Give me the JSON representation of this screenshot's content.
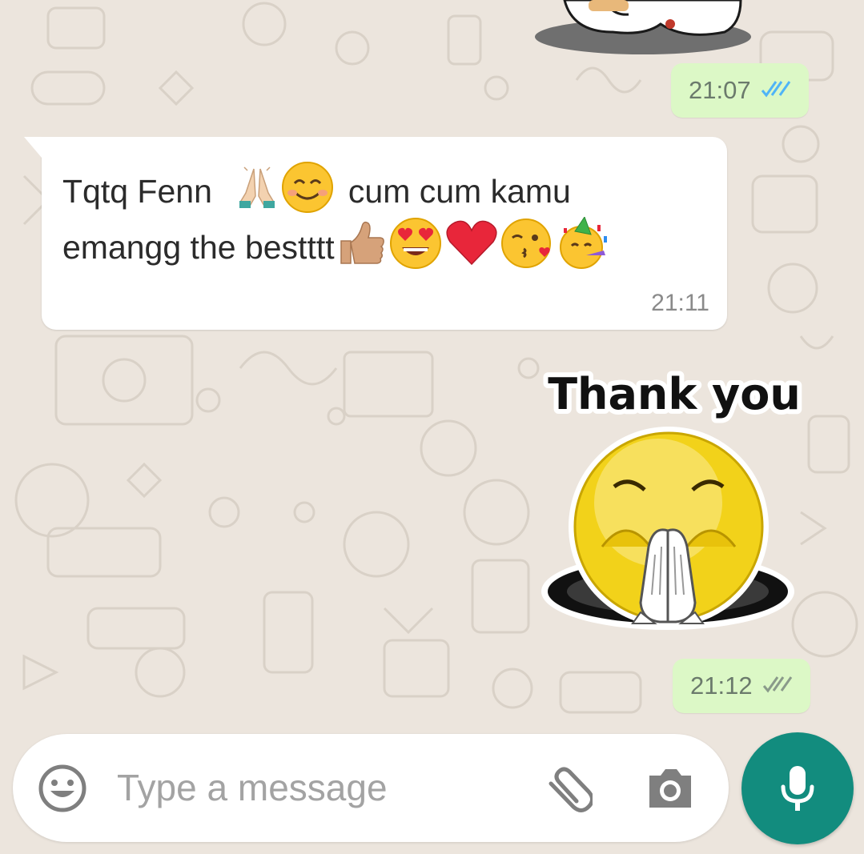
{
  "messages": [
    {
      "direction": "out",
      "type": "sticker",
      "time": "21:07",
      "status": "read"
    },
    {
      "direction": "in",
      "type": "text",
      "line1_text_a": "Tqtq Fenn",
      "line1_emojis": [
        "folded-hands-emoji",
        "smiling-face-emoji"
      ],
      "line1_text_b": "cum cum kamu",
      "line2_text": "emangg the bestttt",
      "line2_emojis": [
        "thumbs-up-emoji",
        "heart-eyes-emoji",
        "red-heart-emoji",
        "kissing-face-emoji",
        "partying-face-emoji"
      ],
      "time": "21:11"
    },
    {
      "direction": "out",
      "type": "sticker",
      "sticker_text": "Thank you",
      "time": "21:12",
      "status": "read"
    }
  ],
  "composer": {
    "placeholder": "Type a message",
    "icons": [
      "emoji-icon",
      "attachment-icon",
      "camera-icon",
      "microphone-icon"
    ]
  },
  "colors": {
    "wallpaper": "#ece5dd",
    "outgoing_bubble": "#dcf8c6",
    "incoming_bubble": "#ffffff",
    "read_ticks": "#4fb4f7",
    "mic_button": "#128c7e"
  }
}
